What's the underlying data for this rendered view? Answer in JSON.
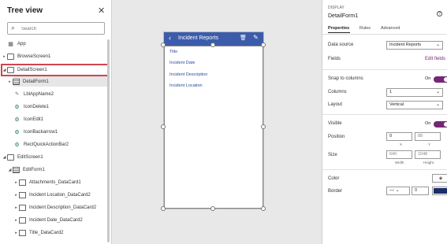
{
  "tree": {
    "title": "Tree view",
    "search_placeholder": "Search",
    "items": [
      {
        "label": "App"
      },
      {
        "label": "BrowseScreen1"
      },
      {
        "label": "DetailScreen1"
      },
      {
        "label": "DetailForm1"
      },
      {
        "label": "LblAppName2"
      },
      {
        "label": "IconDelete1"
      },
      {
        "label": "IconEdit1"
      },
      {
        "label": "IconBackarrow1"
      },
      {
        "label": "RectQuickActionBar2"
      },
      {
        "label": "EditScreen1"
      },
      {
        "label": "EditForm1"
      },
      {
        "label": "Attachments_DataCard1"
      },
      {
        "label": "Incident Location_DataCard2"
      },
      {
        "label": "Incident Description_DataCard2"
      },
      {
        "label": "Incident Date_DataCard2"
      },
      {
        "label": "Title_DataCard2"
      }
    ]
  },
  "canvas": {
    "header_title": "Incident Reports",
    "fields": [
      "Title",
      "Incident Date",
      "Incident Description",
      "Incident Location"
    ],
    "colors": {
      "header": "#3c5cab",
      "field_text": "#2a4d9b"
    }
  },
  "props": {
    "type": "DISPLAY",
    "name": "DetailForm1",
    "tabs": [
      "Properties",
      "Rules",
      "Advanced"
    ],
    "data_source_label": "Data source",
    "data_source_value": "Incident Reports",
    "fields_label": "Fields",
    "edit_fields": "Edit fields",
    "snap_label": "Snap to columns",
    "snap_value": "On",
    "columns_label": "Columns",
    "columns_value": "1",
    "layout_label": "Layout",
    "layout_value": "Vertical",
    "visible_label": "Visible",
    "visible_value": "On",
    "position_label": "Position",
    "pos_x": "0",
    "pos_y": "88",
    "x_label": "X",
    "y_label": "Y",
    "size_label": "Size",
    "width": "640",
    "height": "1048",
    "width_label": "Width",
    "height_label": "Height",
    "color_label": "Color",
    "border_label": "Border",
    "border_width": "0",
    "border_color": "#1b2d6b",
    "accent": "#742774"
  }
}
